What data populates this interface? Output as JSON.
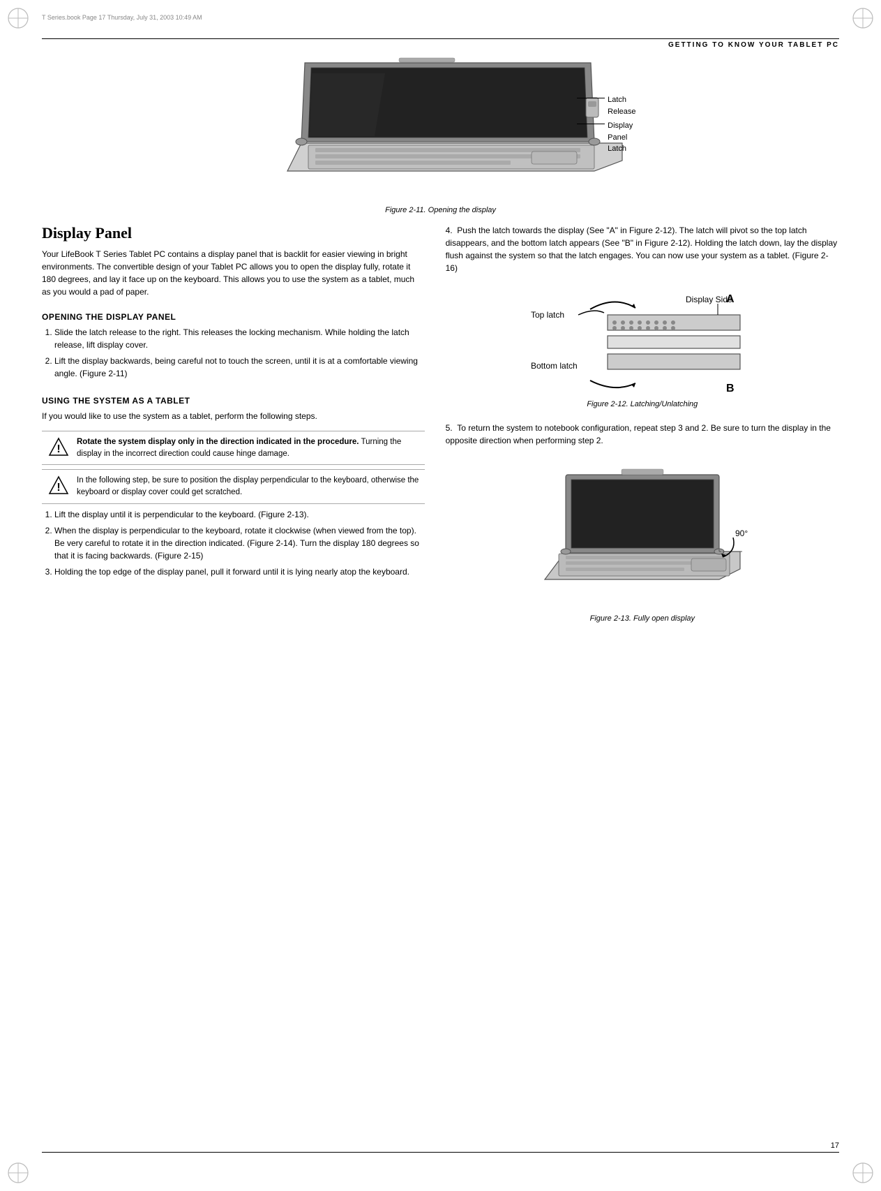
{
  "book_header": "T Series.book  Page 17  Thursday, July 31, 2003  10:49 AM",
  "page_header_title": "Getting to Know Your Tablet PC",
  "page_number": "17",
  "fig11_caption": "Figure 2-11. Opening the display",
  "fig12_caption": "Figure 2-12. Latching/Unlatching",
  "fig13_caption": "Figure 2-13. Fully open display",
  "section_title": "Display Panel",
  "section_body": "Your LifeBook T Series Tablet PC contains a display panel that is backlit for easier viewing in bright environments. The convertible design of your Tablet PC allows you to open the display fully, rotate it 180 degrees, and lay it face up on the keyboard. This allows you to use the system as a tablet, much as you would a pad of paper.",
  "opening_title": "OPENING THE DISPLAY PANEL",
  "opening_steps": [
    "Slide the latch release to the right. This releases the locking mechanism. While holding the latch release, lift display cover.",
    "Lift the display backwards, being careful not to touch the screen, until it is at a comfortable viewing angle. (Figure 2-11)"
  ],
  "using_title": "USING THE SYSTEM AS A TABLET",
  "using_intro": "If you would like to use the system as a tablet, perform the following steps.",
  "warn1_bold": "Rotate the system display only in the direction indicated in the procedure.",
  "warn1_body": "Turning the display in the incorrect direction could cause hinge damage.",
  "warn2_body": "In the following step, be sure to position the display perpendicular to the keyboard, otherwise the keyboard or display cover could get scratched.",
  "using_steps": [
    "Lift the display until it is perpendicular to the keyboard. (Figure 2-13).",
    "When the display is perpendicular to the keyboard, rotate it clockwise (when viewed from the top). Be very careful to rotate it in the direction indicated. (Figure 2-14). Turn the display 180 degrees so that it is facing backwards. (Figure 2-15)",
    "Holding the top edge of the display panel, pull it forward until it is lying nearly atop the keyboard."
  ],
  "right_step4": "4.  Push the latch towards the display (See \"A\" in Figure 2-12). The latch will pivot so the top latch disappears, and the bottom latch appears (See \"B\" in Figure 2-12). Holding the latch down, lay the display flush against the system so that the latch engages. You can now use your system as a tablet. (Figure 2-16)",
  "right_step5": "5.  To return the system to notebook configuration, repeat step 3 and 2. Be sure to turn the display in the opposite direction when performing step 2.",
  "latch_labels": {
    "top_latch": "Top latch",
    "bottom_latch": "Bottom latch",
    "display_side": "Display Side",
    "label_a": "A",
    "label_b": "B"
  },
  "laptop_labels": {
    "latch_release": "Latch\nRelease",
    "display_panel_latch": "Display\nPanel\nLatch"
  },
  "angle_label": "90°",
  "accent_color": "#000000"
}
